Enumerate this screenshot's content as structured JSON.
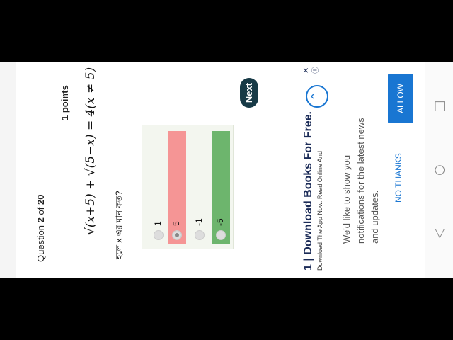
{
  "quiz": {
    "question_label_prefix": "Question",
    "question_number": "2",
    "question_of": "of",
    "question_total": "20",
    "points": "1 points",
    "formula": "√(x+5) + √(5−x) = 4(x ≠ 5)",
    "prompt": "হলে x এর মান কত?",
    "options": [
      {
        "label": "1",
        "state": "none"
      },
      {
        "label": "5",
        "state": "wrong"
      },
      {
        "label": "-1",
        "state": "none"
      },
      {
        "label": "-5",
        "state": "correct"
      }
    ],
    "next_label": "Next"
  },
  "ad": {
    "title": "Download Books For Free.",
    "subtitle": "Download The App Now. Read Online And",
    "title_prefix": "1"
  },
  "notification": {
    "message": "We'd like to show you notifications for the latest news and updates.",
    "allow_label": "ALLOW",
    "no_thanks_label": "NO THANKS"
  },
  "nav_icons": [
    "back-triangle-icon",
    "home-circle-icon",
    "recents-square-icon"
  ],
  "colors": {
    "wrong": "#f59595",
    "correct": "#6db56d",
    "next": "#173a46",
    "accent": "#1976d2"
  }
}
